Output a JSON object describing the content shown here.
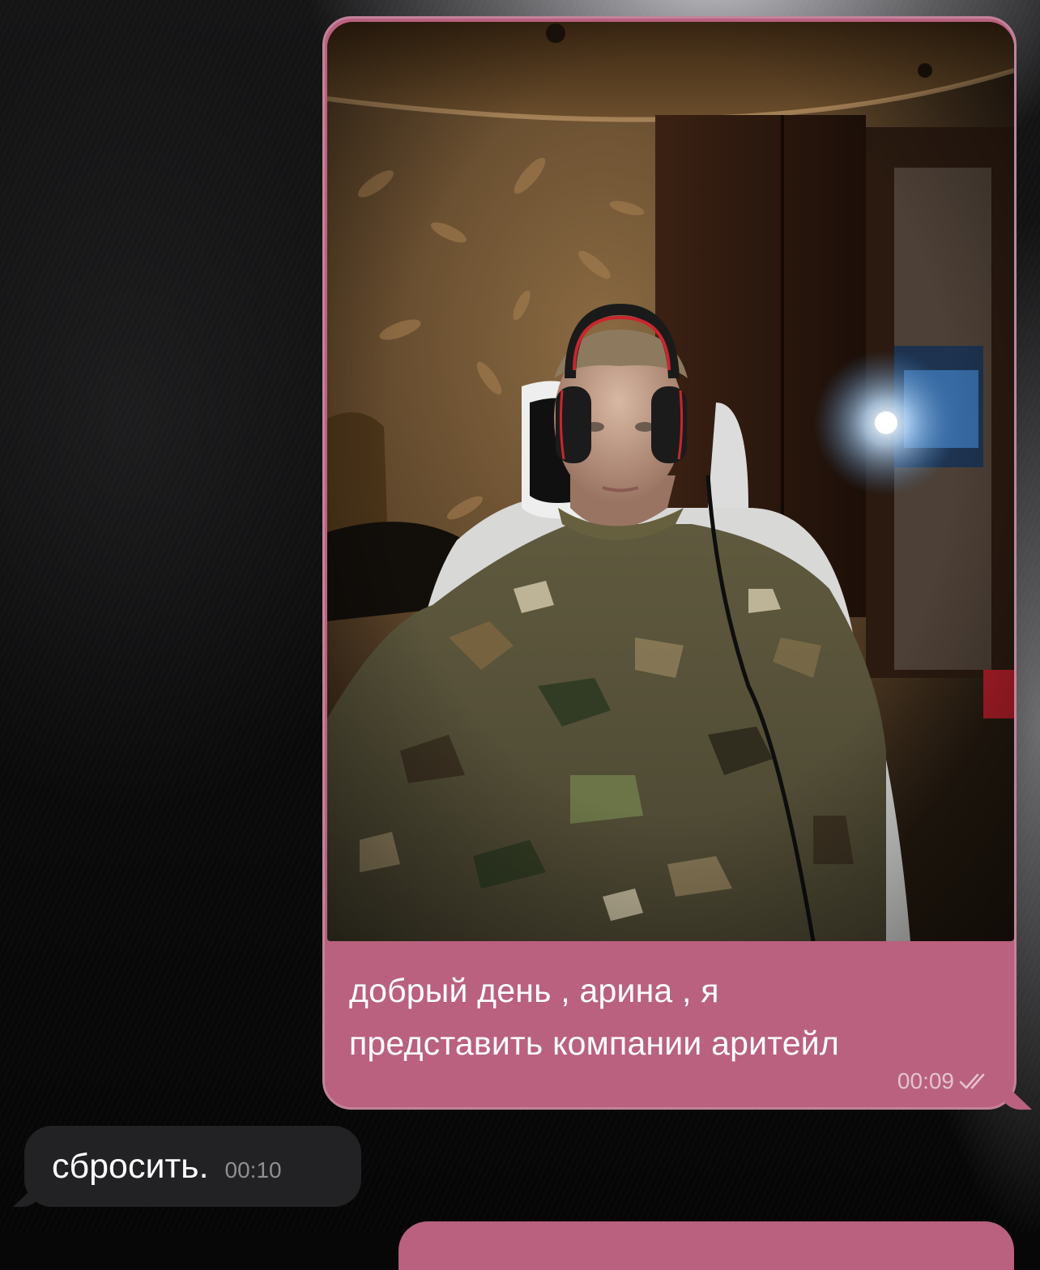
{
  "messages": [
    {
      "direction": "outgoing",
      "kind": "photo",
      "caption": "добрый день , арина , я\nпредставить компании аритейл",
      "time": "00:09",
      "status": "read-double-check-icon",
      "bubble_color": "#b9617f"
    },
    {
      "direction": "incoming",
      "kind": "text",
      "text": "сбросить.",
      "time": "00:10",
      "bubble_color": "#222224"
    }
  ]
}
